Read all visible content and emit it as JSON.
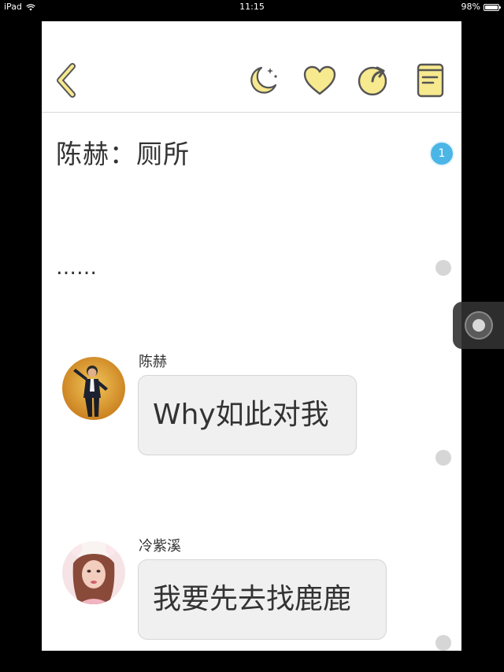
{
  "status_bar": {
    "device": "iPad",
    "time": "11:15",
    "battery_text": "98%",
    "battery_level": 0.98
  },
  "toolbar": {
    "back_icon": "chevron-left-icon",
    "night_mode_icon": "moon-icon",
    "favorite_icon": "heart-icon",
    "share_icon": "share-icon",
    "catalog_icon": "book-icon",
    "icon_color": "#f7e98e",
    "icon_stroke": "#555555"
  },
  "story": {
    "scene_text": "陈赫：厕所",
    "ellipsis_text": "……",
    "badge_count": "1",
    "badge_color": "#4bb6e6"
  },
  "messages": [
    {
      "sender": "陈赫",
      "text": "Why如此对我"
    },
    {
      "sender": "冷紫溪",
      "text": "我要先去找鹿鹿"
    }
  ]
}
